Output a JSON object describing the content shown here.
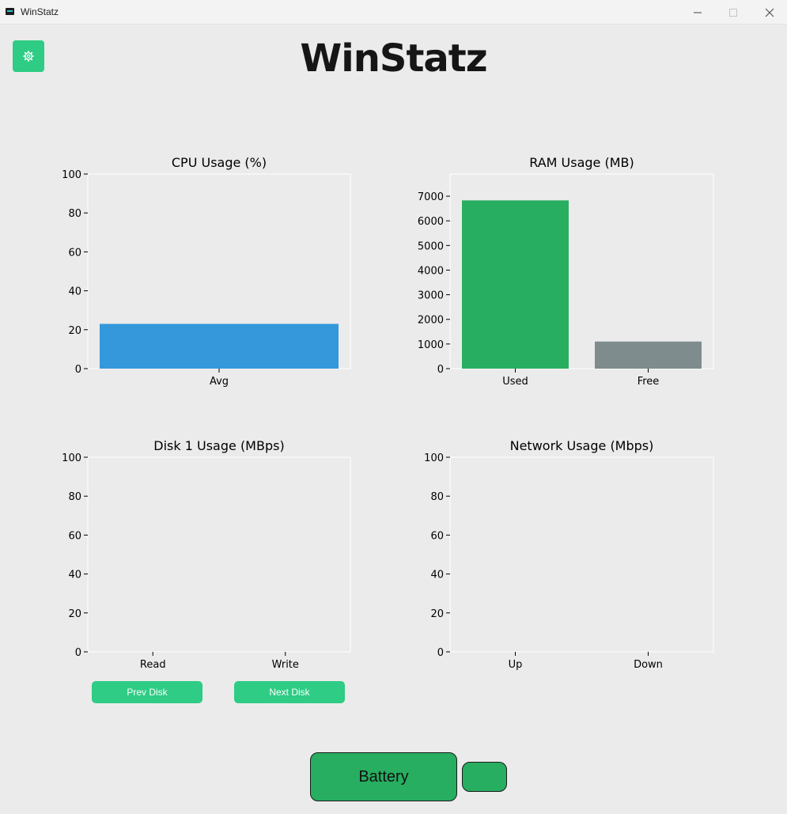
{
  "window": {
    "title": "WinStatz"
  },
  "app": {
    "heading": "WinStatz",
    "settings_icon": "gear-icon"
  },
  "colors": {
    "accent": "#2ecc84",
    "cpu_bar": "#3498db",
    "ram_used": "#27ae60",
    "ram_free": "#7f8c8d",
    "battery": "#27ae60"
  },
  "chart_data": [
    {
      "id": "cpu",
      "type": "bar",
      "title": "CPU Usage (%)",
      "categories": [
        "Avg"
      ],
      "values": [
        23
      ],
      "colors": [
        "#3498db"
      ],
      "ylim": [
        0,
        100
      ],
      "yticks": [
        0,
        20,
        40,
        60,
        80,
        100
      ],
      "xlabel": "",
      "ylabel": ""
    },
    {
      "id": "ram",
      "type": "bar",
      "title": "RAM Usage (MB)",
      "categories": [
        "Used",
        "Free"
      ],
      "values": [
        6830,
        1100
      ],
      "colors": [
        "#27ae60",
        "#7f8c8d"
      ],
      "ylim": [
        0,
        7900
      ],
      "yticks": [
        0,
        1000,
        2000,
        3000,
        4000,
        5000,
        6000,
        7000
      ],
      "xlabel": "",
      "ylabel": ""
    },
    {
      "id": "disk",
      "type": "bar",
      "title": "Disk 1 Usage (MBps)",
      "categories": [
        "Read",
        "Write"
      ],
      "values": [
        0,
        0
      ],
      "colors": [
        "#27ae60",
        "#27ae60"
      ],
      "ylim": [
        0,
        100
      ],
      "yticks": [
        0,
        20,
        40,
        60,
        80,
        100
      ],
      "xlabel": "",
      "ylabel": ""
    },
    {
      "id": "net",
      "type": "bar",
      "title": "Network Usage (Mbps)",
      "categories": [
        "Up",
        "Down"
      ],
      "values": [
        0,
        0
      ],
      "colors": [
        "#27ae60",
        "#27ae60"
      ],
      "ylim": [
        0,
        100
      ],
      "yticks": [
        0,
        20,
        40,
        60,
        80,
        100
      ],
      "xlabel": "",
      "ylabel": ""
    }
  ],
  "disk_nav": {
    "prev_label": "Prev Disk",
    "next_label": "Next Disk"
  },
  "battery": {
    "label": "Battery"
  }
}
